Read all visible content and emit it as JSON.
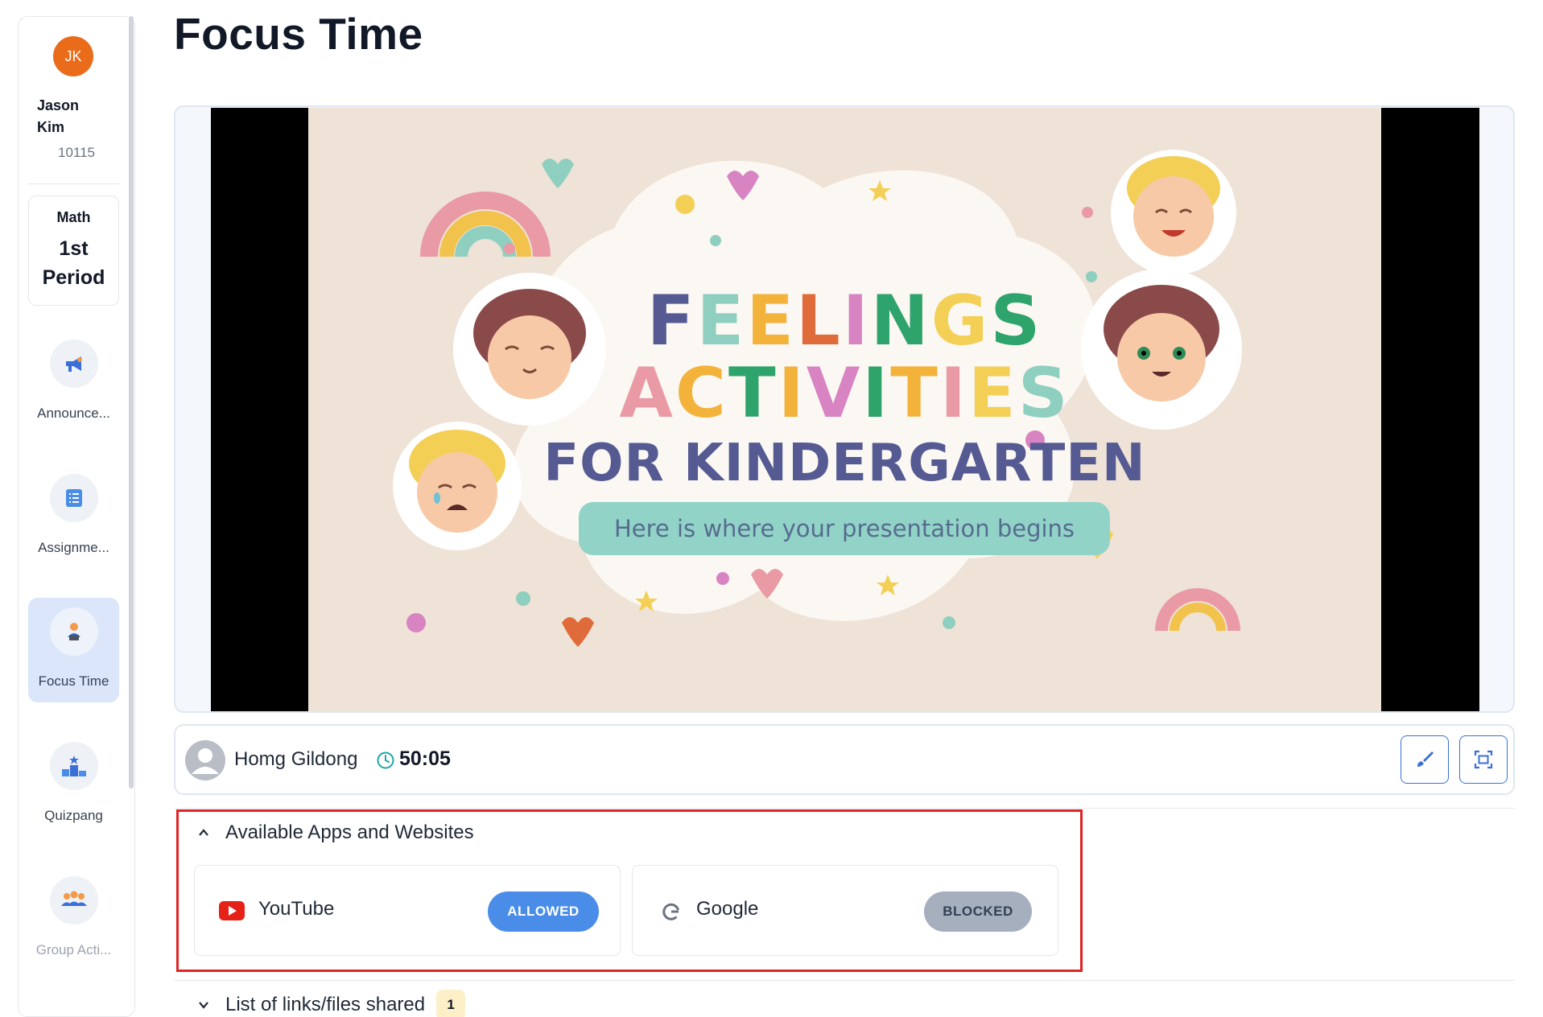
{
  "page": {
    "title": "Focus Time"
  },
  "user": {
    "initials": "JK",
    "name": "Jason Kim",
    "id": "10115"
  },
  "class_info": {
    "subject": "Math",
    "period": "1st Period"
  },
  "nav": [
    {
      "label": "Announce...",
      "icon": "megaphone-icon"
    },
    {
      "label": "Assignme...",
      "icon": "list-icon"
    },
    {
      "label": "Focus Time",
      "icon": "person-at-desk-icon",
      "active": true
    },
    {
      "label": "Quizpang",
      "icon": "podium-icon"
    },
    {
      "label": "Group Acti...",
      "icon": "group-icon"
    }
  ],
  "slide": {
    "title_line1": "FEELINGS",
    "title_line2": "ACTIVITIES",
    "title_line3": "FOR KINDERGARTEN",
    "subtitle": "Here is where your presentation begins"
  },
  "student": {
    "name": "Homg Gildong",
    "timer": "50:05"
  },
  "apps_section": {
    "header": "Available Apps and Websites",
    "apps": [
      {
        "name": "YouTube",
        "status": "ALLOWED",
        "icon": "youtube-icon"
      },
      {
        "name": "Google",
        "status": "BLOCKED",
        "icon": "google-icon"
      }
    ]
  },
  "links_section": {
    "header": "List of links/files shared",
    "count": "1"
  },
  "colors": {
    "accent": "#3a6fd8",
    "allowed": "#4a8de8",
    "blocked": "#a5afbd",
    "avatar": "#ea6b1a",
    "highlight": "#e02424"
  }
}
